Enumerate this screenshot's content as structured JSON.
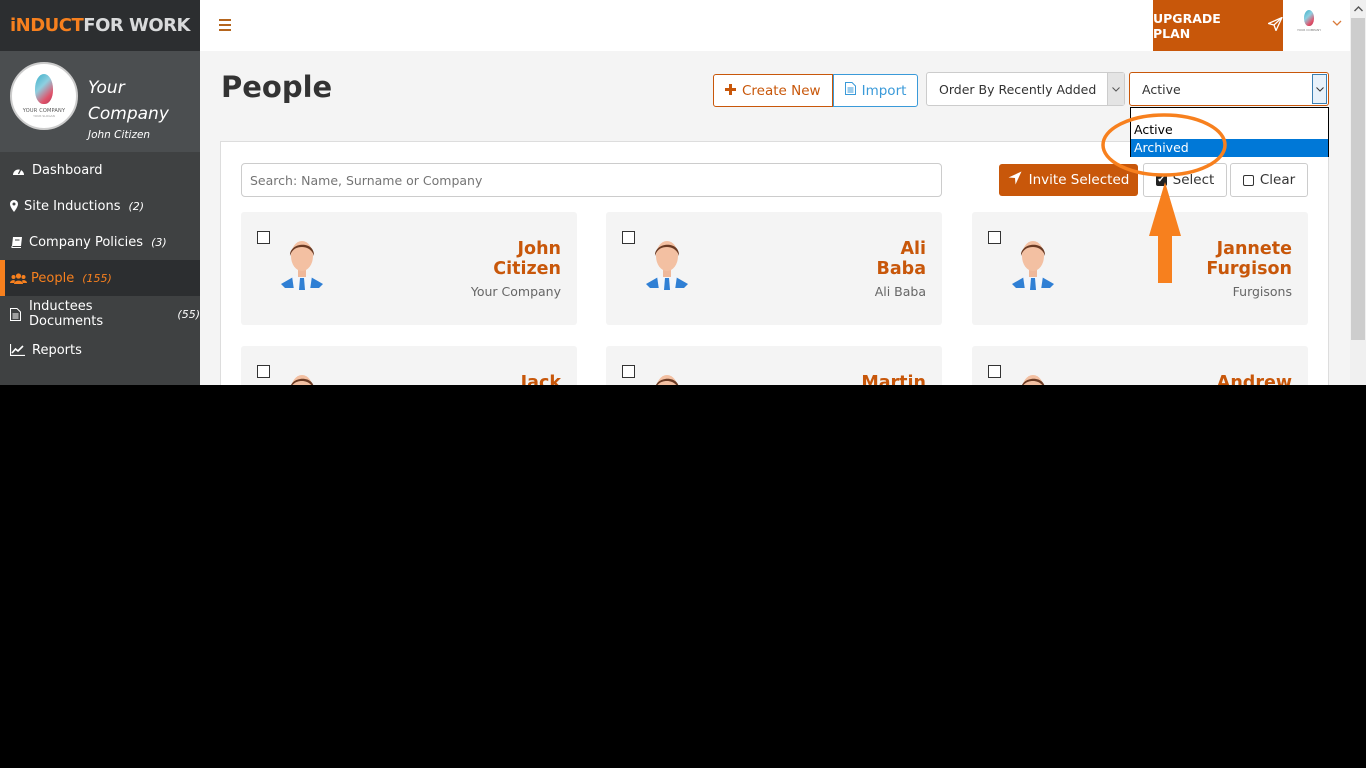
{
  "brand": {
    "part1": "iNDUCT",
    "part2": "FOR WORK"
  },
  "profile": {
    "logo_text": "YOUR COMPANY",
    "logo_sub": "YOUR SLOGAN",
    "company": "Your Company",
    "user": "John Citizen"
  },
  "sidebar": {
    "items": [
      {
        "icon": "dashboard-icon",
        "label": "Dashboard",
        "count": ""
      },
      {
        "icon": "map-marker-icon",
        "label": "Site Inductions",
        "count": "(2)"
      },
      {
        "icon": "book-icon",
        "label": "Company Policies",
        "count": "(3)"
      },
      {
        "icon": "users-icon",
        "label": "People",
        "count": "(155)",
        "active": true
      },
      {
        "icon": "document-icon",
        "label": "Inductees Documents",
        "count": "(55)"
      },
      {
        "icon": "line-chart-icon",
        "label": "Reports",
        "count": ""
      }
    ]
  },
  "topbar": {
    "upgrade_label": "UPGRADE PLAN"
  },
  "page": {
    "title": "People",
    "create_label": "Create New",
    "import_label": "Import",
    "order_select": {
      "value": "Order By Recently Added"
    },
    "status_select": {
      "value": "Active",
      "options": [
        "Active",
        "Archived"
      ],
      "highlighted": "Archived"
    }
  },
  "toolbar": {
    "search_placeholder": "Search: Name, Surname or Company",
    "invite_label": "Invite Selected",
    "select_label": "Select",
    "clear_label": "Clear"
  },
  "people": [
    {
      "first": "John",
      "last": "Citizen",
      "company": "Your Company"
    },
    {
      "first": "Ali",
      "last": "Baba",
      "company": "Ali Baba"
    },
    {
      "first": "Jannete",
      "last": "Furgison",
      "company": "Furgisons"
    },
    {
      "first": "Jack",
      "last": "",
      "company": ""
    },
    {
      "first": "Martin",
      "last": "",
      "company": ""
    },
    {
      "first": "Andrew",
      "last": "",
      "company": ""
    }
  ],
  "colors": {
    "accent": "#c8570a",
    "sidebar_accent": "#f7801e",
    "link_blue": "#3a9ad9",
    "annotation": "#f7801e",
    "highlight": "#0078d7"
  }
}
